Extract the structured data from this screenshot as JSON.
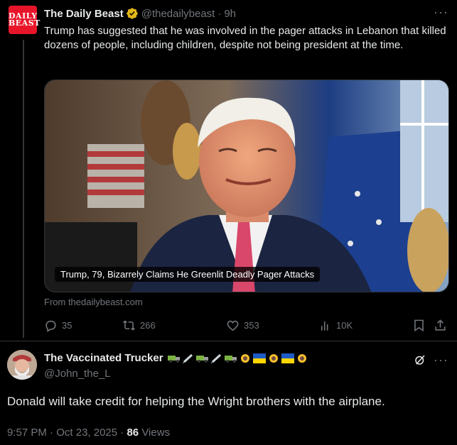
{
  "tweet1": {
    "avatar": {
      "line1": "DAILY",
      "line2": "BEAST",
      "color": "#e8152a"
    },
    "author_name": "The Daily Beast",
    "handle": "@thedailybeast",
    "separator": "·",
    "time": "9h",
    "verified_icon": "gold-verified-badge",
    "more_label": "···",
    "text": "Trump has suggested that he was involved in the pager attacks in Lebanon that killed dozens of people, including children, despite not being president at the time.",
    "media_caption": "Trump, 79, Bizarrely Claims He Greenlit Deadly Pager Attacks",
    "source": "From thedailybeast.com",
    "actions": {
      "replies": "35",
      "reposts": "266",
      "likes": "353",
      "views": "10K"
    }
  },
  "tweet2": {
    "author_name": "The Vaccinated Trucker",
    "emojis": [
      "truck",
      "syringe",
      "truck",
      "syringe",
      "truck",
      "sunflower",
      "ukraine-flag",
      "sunflower",
      "ukraine-flag",
      "sunflower"
    ],
    "handle": "@John_the_L",
    "more_label": "···",
    "text": "Donald will take credit for helping the Wright brothers with the airplane.",
    "time": "9:57 PM",
    "date": "Oct 23, 2025",
    "separator": "·",
    "views_count": "86",
    "views_label": "Views"
  },
  "colors": {
    "background": "#000000",
    "text": "#e7e9ea",
    "muted": "#71767b",
    "border": "#2f3336",
    "verified_gold": "#e2b719"
  }
}
